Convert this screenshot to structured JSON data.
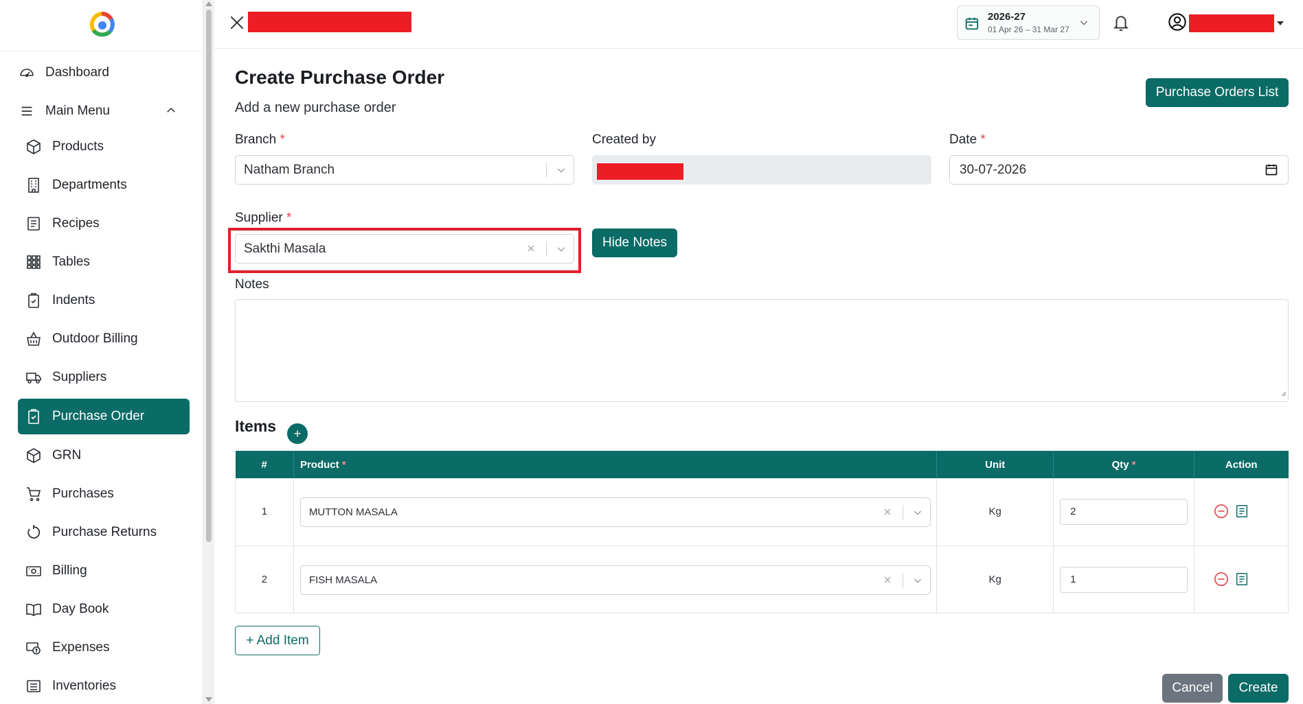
{
  "sidebar": {
    "dashboard": "Dashboard",
    "main_menu": "Main Menu",
    "items": [
      {
        "label": "Products",
        "icon": "box-icon"
      },
      {
        "label": "Departments",
        "icon": "building-icon"
      },
      {
        "label": "Recipes",
        "icon": "recipe-icon"
      },
      {
        "label": "Tables",
        "icon": "grid-icon"
      },
      {
        "label": "Indents",
        "icon": "clipboard-icon"
      },
      {
        "label": "Outdoor Billing",
        "icon": "basket-icon"
      },
      {
        "label": "Suppliers",
        "icon": "truck-icon"
      },
      {
        "label": "Purchase Order",
        "icon": "clipboard-check-icon",
        "active": true
      },
      {
        "label": "GRN",
        "icon": "box-icon"
      },
      {
        "label": "Purchases",
        "icon": "cart-icon"
      },
      {
        "label": "Purchase Returns",
        "icon": "return-icon"
      },
      {
        "label": "Billing",
        "icon": "cash-icon"
      },
      {
        "label": "Day Book",
        "icon": "book-icon"
      },
      {
        "label": "Expenses",
        "icon": "money-icon"
      },
      {
        "label": "Inventories",
        "icon": "list-icon"
      }
    ]
  },
  "header": {
    "fy_year": "2026-27",
    "fy_range": "01 Apr 26 – 31 Mar 27"
  },
  "page": {
    "title": "Create Purchase Order",
    "subtitle": "Add a new purchase order",
    "list_button": "Purchase Orders List"
  },
  "form": {
    "branch_label": "Branch",
    "branch_value": "Natham Branch",
    "created_by_label": "Created by",
    "date_label": "Date",
    "date_value": "30-07-2026",
    "supplier_label": "Supplier",
    "supplier_value": "Sakthi Masala",
    "hide_notes": "Hide Notes",
    "notes_label": "Notes",
    "required_mark": "*"
  },
  "items": {
    "title": "Items",
    "plus": "+",
    "columns": {
      "num": "#",
      "product": "Product",
      "unit": "Unit",
      "qty": "Qty",
      "action": "Action"
    },
    "rows": [
      {
        "num": "1",
        "product": "MUTTON MASALA",
        "unit": "Kg",
        "qty": "2"
      },
      {
        "num": "2",
        "product": "FISH MASALA",
        "unit": "Kg",
        "qty": "1"
      }
    ],
    "add_item": "+ Add Item"
  },
  "footer": {
    "cancel": "Cancel",
    "create": "Create"
  },
  "colors": {
    "accent": "#0b6b66",
    "highlight": "#e01e2b",
    "redaction": "#ee1c25"
  }
}
